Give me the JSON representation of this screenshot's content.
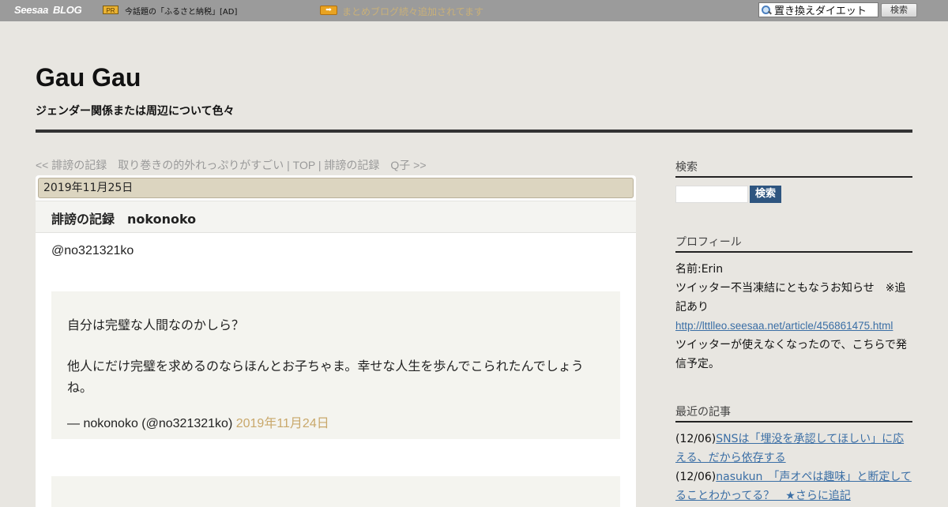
{
  "topbar": {
    "logo_seesaa": "Seesaa",
    "logo_blog": "BLOG",
    "pr_badge": "PR",
    "ad_text": "今話題の「ふるさと納税」[AD]",
    "notice_text": "まとめブログ続々追加されてます",
    "search_value": "置き換えダイエット",
    "search_button": "検索"
  },
  "header": {
    "title": "Gau Gau",
    "description": "ジェンダー関係または周辺について色々"
  },
  "nav": {
    "prev": "<< 誹謗の記録　取り巻きの的外れっぷりがすごい",
    "sep1": " | ",
    "top": "TOP",
    "sep2": " | ",
    "next": "誹謗の記録　Q子 >>"
  },
  "article": {
    "date": "2019年11月25日",
    "title": "誹謗の記録　nokonoko",
    "handle": "@no321321ko",
    "quote": {
      "line1": "自分は完璧な人間なのかしら？",
      "line2": "他人にだけ完璧を求めるのならほんとお子ちゃま。幸せな人生を歩んでこられたんでしょうね。",
      "cite_author": "— nokonoko (@no321321ko) ",
      "cite_date": "2019年11月24日"
    }
  },
  "sidebar": {
    "search": {
      "heading": "検索",
      "button": "検索"
    },
    "profile": {
      "heading": "プロフィール",
      "name": "名前:Erin",
      "note": "ツイッター不当凍結にともなうお知らせ　※追記あり",
      "link": "http://lttlleo.seesaa.net/article/456861475.html",
      "note2": "ツイッターが使えなくなったので、こちらで発信予定。"
    },
    "recent": {
      "heading": "最近の記事",
      "items": [
        {
          "date": "(12/06)",
          "title": "SNSは「埋没を承認してほしい」に応える、だから依存する"
        },
        {
          "date": "(12/06)",
          "title": "nasukun　「声オペは趣味」と断定してることわかってる？　★さらに追記"
        }
      ]
    }
  }
}
